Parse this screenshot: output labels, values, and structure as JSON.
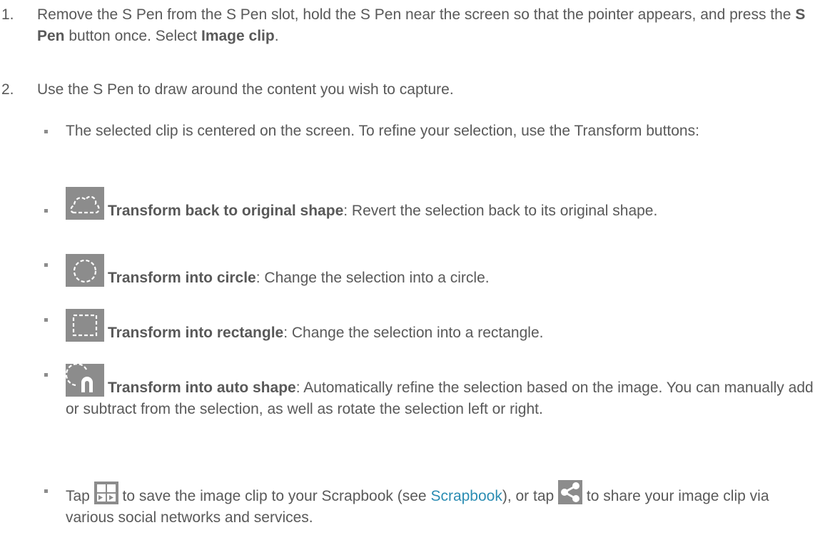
{
  "step1": {
    "num": "1.",
    "t1": "Remove the S Pen from the S Pen slot, hold the S Pen near the screen so that the pointer appears, and press the ",
    "b1": "S Pen",
    "t2": " button once. Select ",
    "b2": "Image clip",
    "t3": "."
  },
  "step2": {
    "num": "2.",
    "text": "Use the S Pen to draw around the content you wish to capture."
  },
  "bullets": {
    "intro": "The selected clip is centered on the screen. To refine your selection, use the Transform buttons:",
    "original": {
      "icon": "transform-original-shape-icon",
      "title": "Transform back to original shape",
      "desc": ": Revert the selection back to its original shape."
    },
    "circle": {
      "icon": "transform-circle-icon",
      "title": "Transform into circle",
      "desc": ": Change the selection into a circle."
    },
    "rectangle": {
      "icon": "transform-rectangle-icon",
      "title": "Transform into rectangle",
      "desc": ": Change the selection into a rectangle."
    },
    "auto": {
      "icon": "transform-auto-shape-icon",
      "title": "Transform into auto shape",
      "desc": ": Automatically refine the selection based on the image. You can manually add or subtract from the selection, as well as rotate the selection left or right."
    },
    "save": {
      "t1": "Tap ",
      "icon1": "save-to-scrapbook-icon",
      "t2": " to save the image clip to your Scrapbook (see ",
      "link": "Scrapbook",
      "t3": "), or tap ",
      "icon2": "share-icon",
      "t4": " to share your image clip via various social networks and services."
    }
  },
  "colors": {
    "text": "#595959",
    "link": "#2b8db3",
    "icon_bg": "#8c8c8c"
  }
}
